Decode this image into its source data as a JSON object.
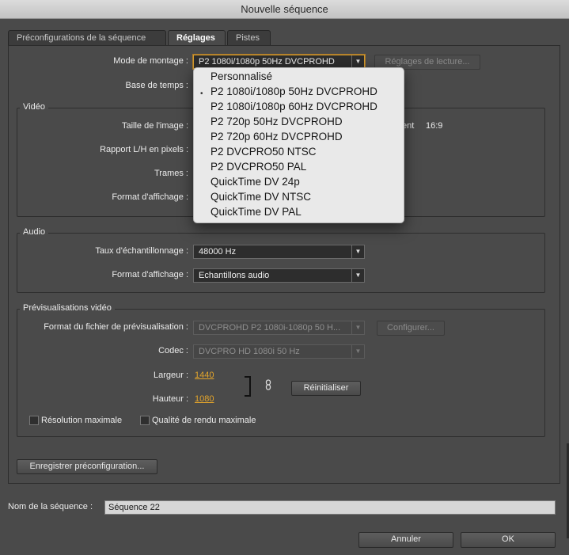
{
  "window": {
    "title": "Nouvelle séquence"
  },
  "tabs": [
    {
      "label": "Préconfigurations de la séquence"
    },
    {
      "label": "Réglages"
    },
    {
      "label": "Pistes"
    }
  ],
  "general": {
    "mode_label": "Mode de montage :",
    "mode_value": "P2 1080i/1080p 50Hz DVCPROHD",
    "playback_button": "Réglages de lecture...",
    "timebase_label": "Base de temps :"
  },
  "video": {
    "title": "Vidéo",
    "frame_size_label": "Taille de l'image :",
    "aspect_suffix": "ent",
    "aspect_value": "16:9",
    "pixel_aspect_label": "Rapport L/H en pixels :",
    "fields_label": "Trames :",
    "display_format_label": "Format d'affichage :"
  },
  "dropdown": {
    "items": [
      "Personnalisé",
      "P2 1080i/1080p 50Hz DVCPROHD",
      "P2 1080i/1080p 60Hz DVCPROHD",
      "P2 720p 50Hz DVCPROHD",
      "P2 720p 60Hz DVCPROHD",
      "P2 DVCPRO50 NTSC",
      "P2 DVCPRO50 PAL",
      "QuickTime DV 24p",
      "QuickTime DV NTSC",
      "QuickTime DV PAL"
    ],
    "selected_index": 1,
    "bullet": "•"
  },
  "audio": {
    "title": "Audio",
    "sample_rate_label": "Taux d'échantillonnage :",
    "sample_rate_value": "48000 Hz",
    "display_format_label": "Format d'affichage :",
    "display_format_value": "Echantillons audio"
  },
  "preview": {
    "title": "Prévisualisations vidéo",
    "file_format_label": "Format du fichier de prévisualisation :",
    "file_format_value": "DVCPROHD P2 1080i-1080p 50 H...",
    "configure_button": "Configurer...",
    "codec_label": "Codec :",
    "codec_value": "DVCPRO HD 1080i 50 Hz",
    "width_label": "Largeur :",
    "width_value": "1440",
    "height_label": "Hauteur :",
    "height_value": "1080",
    "reset_button": "Réinitialiser",
    "max_resolution_label": "Résolution maximale",
    "max_quality_label": "Qualité de rendu maximale"
  },
  "save_preset_button": "Enregistrer préconfiguration...",
  "sequence_name": {
    "label": "Nom de la séquence :",
    "value": "Séquence 22"
  },
  "footer": {
    "cancel": "Annuler",
    "ok": "OK"
  },
  "colors": {
    "accent": "#e4a52b",
    "background": "#4a4a4a"
  },
  "icons": {
    "dropdown": "chevron-down-icon",
    "link": "chain-link-icon"
  }
}
